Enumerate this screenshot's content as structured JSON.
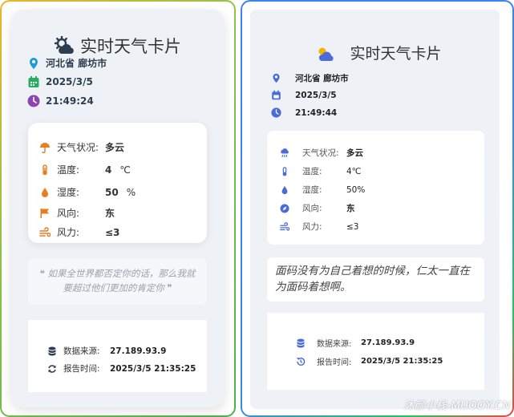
{
  "left": {
    "title": "实时天气卡片",
    "location": "河北省 廊坊市",
    "date": "2025/3/5",
    "time": "21:49:24",
    "weather": {
      "condition_label": "天气状况:",
      "condition_value": "多云",
      "temp_label": "温度:",
      "temp_value": "4",
      "temp_unit": "℃",
      "humidity_label": "湿度:",
      "humidity_value": "50",
      "humidity_unit": "%",
      "wind_dir_label": "风向:",
      "wind_dir_value": "东",
      "wind_power_label": "风力:",
      "wind_power_value": "≤3"
    },
    "quote": "❝ 如果全世界都否定你的话，那么我就要超过他们更加的肯定你 ❞",
    "source_label": "数据来源:",
    "source_value": "27.189.93.9",
    "report_label": "报告时间:",
    "report_value": "2025/3/5 21:35:25"
  },
  "right": {
    "title": "实时天气卡片",
    "location": "河北省 廊坊市",
    "date": "2025/3/5",
    "time": "21:49:44",
    "weather": {
      "condition_label": "天气状况:",
      "condition_value": "多云",
      "temp_label": "温度:",
      "temp_value": "4℃",
      "humidity_label": "湿度:",
      "humidity_value": "50%",
      "wind_dir_label": "风向:",
      "wind_dir_value": "东",
      "wind_power_label": "风力:",
      "wind_power_value": "≤3"
    },
    "quote": "面码没有为自己着想的时候，仁太一直在为面码着想啊。",
    "source_label": "数据来源:",
    "source_value": "27.189.93.9",
    "report_label": "报告时间:",
    "report_value": "2025/3/5 21:35:25"
  },
  "watermark": "沐颜小栈-MUOOY.CN",
  "icons": {
    "left_title": "cloud-sun-gear-icon",
    "location": "map-pin-icon",
    "calendar": "calendar-icon",
    "clock": "clock-icon",
    "umbrella": "umbrella-icon",
    "thermometer": "thermometer-icon",
    "droplet": "droplet-icon",
    "flag": "flag-icon",
    "wind": "wind-icon",
    "database": "database-icon",
    "refresh": "refresh-icon",
    "right_title": "cloud-sun-icon",
    "cloud_rain": "cloud-rain-icon",
    "compass": "compass-icon",
    "history": "history-icon"
  },
  "colors": {
    "left_location": "#1e9bd7",
    "left_calendar": "#27ae60",
    "left_clock": "#8e44ad",
    "left_weather_icons": "#e67e22",
    "right_icons": "#4a6bd8"
  }
}
